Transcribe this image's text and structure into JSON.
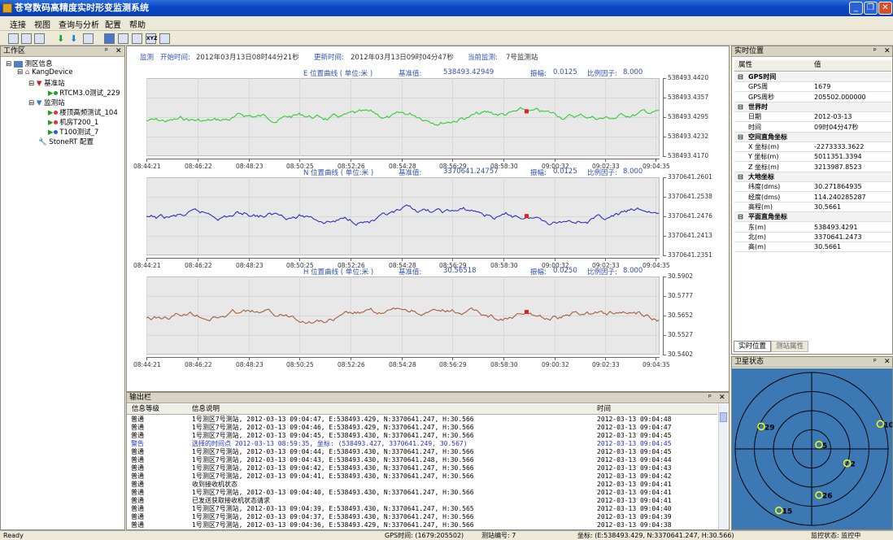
{
  "app": {
    "title": "苍穹数码高精度实时形变监测系统"
  },
  "menu": [
    "连接",
    "视图",
    "查询与分析",
    "配置",
    "帮助"
  ],
  "toolbar": {
    "label": "XYZ"
  },
  "workspace": {
    "title": "工作区",
    "tree": {
      "root": "测区信息",
      "device": "KangDevice",
      "base_group": "基准站",
      "base": [
        "RTCM3.0测试_229"
      ],
      "monitor_group": "监测站",
      "monitors": [
        "楼顶高频测试_104",
        "机房T200_1",
        "T100测试_7"
      ],
      "config": "StoneRT 配置"
    }
  },
  "monitor_header": {
    "label": "监测",
    "start_label": "开始时间:",
    "start": "2012年03月13日08时44分21秒",
    "update_label": "更新时间:",
    "update": "2012年03月13日09时04分47秒",
    "current_label": "当前监测:",
    "current": "7号监测站"
  },
  "charts": [
    {
      "title": "E 位置曲线 ( 单位:米 )",
      "base_label": "基准值:",
      "base": "538493.42949",
      "amp_label": "振幅:",
      "amp": "0.0125",
      "scale_label": "比例因子:",
      "scale": "8.000",
      "yticks": [
        "538493.4420",
        "538493.4357",
        "538493.4295",
        "538493.4232",
        "538493.4170"
      ],
      "color": "#1fcc1f"
    },
    {
      "title": "N 位置曲线 ( 单位:米 )",
      "base_label": "基准值:",
      "base": "3370641.24757",
      "amp_label": "振幅:",
      "amp": "0.0125",
      "scale_label": "比例因子:",
      "scale": "8.000",
      "yticks": [
        "3370641.2601",
        "3370641.2538",
        "3370641.2476",
        "3370641.2413",
        "3370641.2351"
      ],
      "color": "#2020c0"
    },
    {
      "title": "H 位置曲线 ( 单位:米 )",
      "base_label": "基准值:",
      "base": "30.56518",
      "amp_label": "振幅:",
      "amp": "0.0250",
      "scale_label": "比例因子:",
      "scale": "8.000",
      "yticks": [
        "30.5902",
        "30.5777",
        "30.5652",
        "30.5527",
        "30.5402"
      ],
      "color": "#a0522d"
    }
  ],
  "xticks": [
    "08:44:21",
    "08:46:22",
    "08:48:23",
    "08:50:25",
    "08:52:26",
    "08:54:28",
    "08:56:29",
    "08:58:30",
    "09:00:32",
    "09:02:33",
    "09:04:35"
  ],
  "output": {
    "title": "输出栏",
    "headers": [
      "信息等级",
      "信息说明",
      "时间"
    ],
    "rows": [
      [
        "普通",
        "1号测区7号测站, 2012-03-13 09:04:47, E:538493.429, N:3370641.247, H:30.566",
        "2012-03-13  09:04:48"
      ],
      [
        "普通",
        "1号测区7号测站, 2012-03-13 09:04:46, E:538493.429, N:3370641.247, H:30.566",
        "2012-03-13  09:04:47"
      ],
      [
        "普通",
        "1号测区7号测站, 2012-03-13 09:04:45, E:538493.430, N:3370641.247, H:30.566",
        "2012-03-13  09:04:45"
      ],
      [
        "警告",
        "选择的时间点 2012-03-13 08:59:35, 坐标: (538493.427, 3370641.249, 30.567)",
        "2012-03-13  09:04:45"
      ],
      [
        "普通",
        "1号测区7号测站, 2012-03-13 09:04:44, E:538493.430, N:3370641.247, H:30.566",
        "2012-03-13  09:04:45"
      ],
      [
        "普通",
        "1号测区7号测站, 2012-03-13 09:04:43, E:538493.430, N:3370641.248, H:30.566",
        "2012-03-13  09:04:44"
      ],
      [
        "普通",
        "1号测区7号测站, 2012-03-13 09:04:42, E:538493.430, N:3370641.247, H:30.566",
        "2012-03-13  09:04:43"
      ],
      [
        "普通",
        "1号测区7号测站, 2012-03-13 09:04:41, E:538493.430, N:3370641.247, H:30.566",
        "2012-03-13  09:04:42"
      ],
      [
        "普通",
        "收到接收机状态",
        "2012-03-13  09:04:41"
      ],
      [
        "普通",
        "1号测区7号测站, 2012-03-13 09:04:40, E:538493.430, N:3370641.247, H:30.566",
        "2012-03-13  09:04:41"
      ],
      [
        "普通",
        "已发送获取接收机状态请求",
        "2012-03-13  09:04:41"
      ],
      [
        "普通",
        "1号测区7号测站, 2012-03-13 09:04:39, E:538493.430, N:3370641.247, H:30.565",
        "2012-03-13  09:04:40"
      ],
      [
        "普通",
        "1号测区7号测站, 2012-03-13 09:04:37, E:538493.430, N:3370641.247, H:30.566",
        "2012-03-13  09:04:39"
      ],
      [
        "普通",
        "1号测区7号测站, 2012-03-13 09:04:36, E:538493.429, N:3370641.247, H:30.566",
        "2012-03-13  09:04:38"
      ]
    ]
  },
  "realtime": {
    "title": "实时位置",
    "col_prop": "属性",
    "col_val": "值",
    "rows": [
      {
        "g": "GPS时间"
      },
      {
        "k": "GPS周",
        "v": "1679"
      },
      {
        "k": "GPS周秒",
        "v": "205502.000000"
      },
      {
        "g": "世界时"
      },
      {
        "k": "日期",
        "v": "2012-03-13"
      },
      {
        "k": "时间",
        "v": "09时04分47秒"
      },
      {
        "g": "空间直角坐标"
      },
      {
        "k": "X 坐标(m)",
        "v": "-2273333.3622"
      },
      {
        "k": "Y 坐标(m)",
        "v": "5011351.3394"
      },
      {
        "k": "Z 坐标(m)",
        "v": "3213987.8523"
      },
      {
        "g": "大地坐标"
      },
      {
        "k": "纬度(dms)",
        "v": "30.271864935"
      },
      {
        "k": "经度(dms)",
        "v": "114.240285287"
      },
      {
        "k": "高程(m)",
        "v": "30.5661"
      },
      {
        "g": "平面直角坐标"
      },
      {
        "k": "东(m)",
        "v": "538493.4291"
      },
      {
        "k": "北(m)",
        "v": "3370641.2473"
      },
      {
        "k": "高(m)",
        "v": "30.5661"
      }
    ],
    "tabs": [
      "实时位置",
      "测站属性"
    ]
  },
  "satellite": {
    "title": "卫星状态",
    "sats": [
      {
        "id": "29",
        "az": -66,
        "el": 25
      },
      {
        "id": "10",
        "az": 70,
        "el": 4
      },
      {
        "id": "5",
        "az": 60,
        "el": 80
      },
      {
        "id": "2",
        "az": 112,
        "el": 45
      },
      {
        "id": "26",
        "az": 171,
        "el": 35
      },
      {
        "id": "15",
        "az": -152,
        "el": 8
      }
    ]
  },
  "status": {
    "ready": "Ready",
    "gps": "GPS时间: (1679:205502)",
    "station": "测站编号: 7",
    "coord": "坐标: (E:538493.429, N:3370641.247, H:30.566)",
    "monitor": "监控状态: 监控中"
  }
}
